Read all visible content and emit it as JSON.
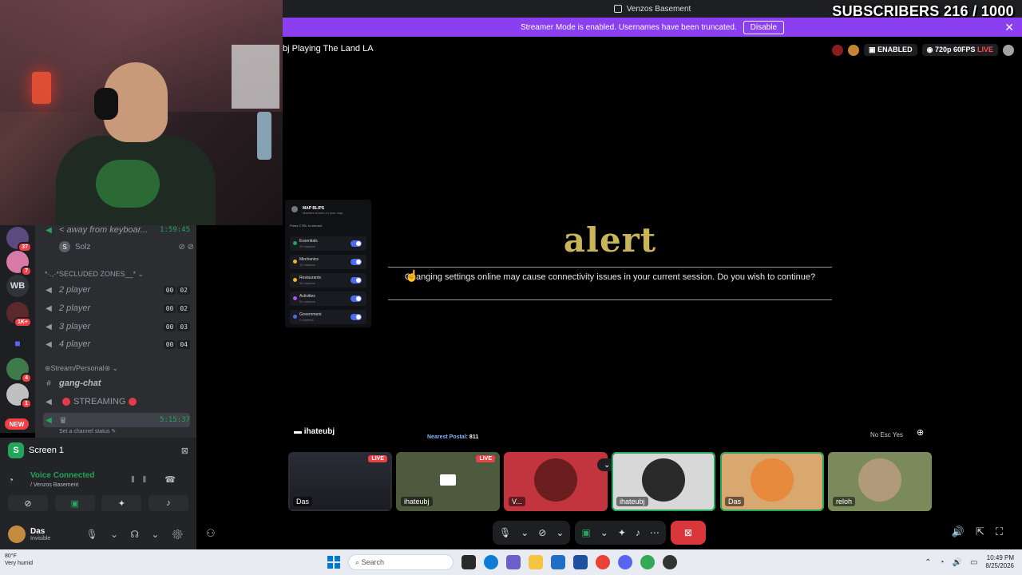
{
  "overlay": {
    "subscribers": "SUBSCRIBERS 216 / 1000"
  },
  "window": {
    "title": "Venzos Basement"
  },
  "banner": {
    "text": "Streamer Mode is enabled. Usernames have been truncated.",
    "disable_label": "Disable",
    "close": "✕"
  },
  "stream": {
    "title": "bj Playing The Land LA",
    "enabled_label": "ENABLED",
    "quality_label": "720p 60FPS",
    "live_label": "LIVE",
    "streamer": "ihateubj",
    "postal_label": "Nearest Postal:",
    "postal_value": "811",
    "no_yes": "No Esc   Yes"
  },
  "map_panel": {
    "title": "MAP BLIPS",
    "subtitle": "Markers shown on your map",
    "hint": "Press CTRL to interact",
    "items": [
      {
        "label": "Essentials",
        "sub": "20 markers",
        "color": "#23a55a"
      },
      {
        "label": "Mechanics",
        "sub": "12 markers",
        "color": "#f0b232"
      },
      {
        "label": "Restaurants",
        "sub": "34 markers",
        "color": "#f0b232"
      },
      {
        "label": "Activities",
        "sub": "51 markers",
        "color": "#a855f7"
      },
      {
        "label": "Government",
        "sub": "0 markers",
        "color": "#4b6cf0"
      }
    ]
  },
  "alert": {
    "title": "alert",
    "message": "Changing settings online may cause connectivity issues in your current session. Do you wish to continue?"
  },
  "servers": {
    "badges": [
      "37",
      "7",
      "1K+",
      "4",
      "1"
    ],
    "wb": "WB",
    "new": "NEW"
  },
  "channels": {
    "afk": {
      "name": "< away from keyboar...",
      "time": "1:59:45"
    },
    "afk_user": {
      "initial": "S",
      "name": "Solz"
    },
    "category1": "*·.,·*SECLUDED ZONES__* ⌄",
    "rooms": [
      {
        "name": "2 player",
        "a": "00",
        "b": "02"
      },
      {
        "name": "2 player",
        "a": "00",
        "b": "02"
      },
      {
        "name": "3 player",
        "a": "00",
        "b": "03"
      },
      {
        "name": "4 player",
        "a": "00",
        "b": "04"
      }
    ],
    "category2": "⊛Stream/Personal⊛ ⌄",
    "gang_chat": "gang-chat",
    "streaming": "STREAMING",
    "selected": {
      "time": "5:15:37",
      "status": "Set a channel status ✎"
    }
  },
  "voice": {
    "screen_label": "Screen 1",
    "connected": "Voice Connected",
    "location": "/ Venzos Basement"
  },
  "user": {
    "name": "Das",
    "status": "Invisible"
  },
  "tiles": [
    {
      "label": "Das",
      "live": "LIVE"
    },
    {
      "label": "ihateubj",
      "live": "LIVE"
    },
    {
      "label": "V..."
    },
    {
      "label": "ihateubj"
    },
    {
      "label": "Das"
    },
    {
      "label": "reloh"
    }
  ],
  "taskbar": {
    "weather_temp": "80°F",
    "weather_desc": "Very humid",
    "search_placeholder": "Search",
    "time": "10:49 PM",
    "date": "8/25/2026"
  },
  "colors": {
    "accent": "#8b3ff0",
    "green": "#23a55a",
    "red": "#da373c",
    "alert_gold": "#c9b45a"
  }
}
